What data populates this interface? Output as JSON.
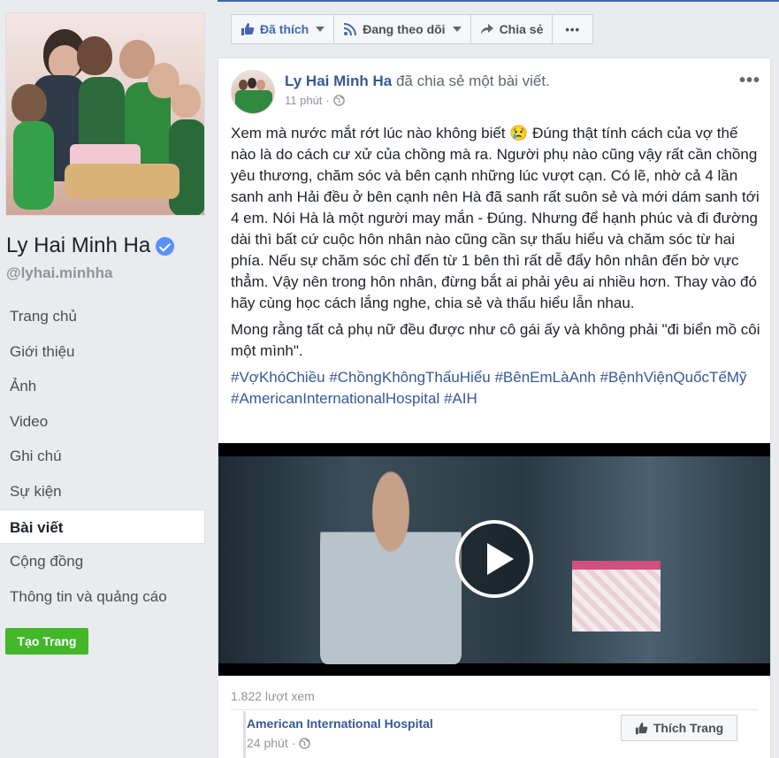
{
  "page": {
    "name": "Ly Hai Minh Ha",
    "handle": "@lyhai.minhha",
    "create_page_label": "Tạo Trang"
  },
  "nav": {
    "items": [
      {
        "label": "Trang chủ",
        "active": false
      },
      {
        "label": "Giới thiệu",
        "active": false
      },
      {
        "label": "Ảnh",
        "active": false
      },
      {
        "label": "Video",
        "active": false
      },
      {
        "label": "Ghi chú",
        "active": false
      },
      {
        "label": "Sự kiện",
        "active": false
      },
      {
        "label": "Bài viết",
        "active": true
      },
      {
        "label": "Cộng đồng",
        "active": false
      },
      {
        "label": "Thông tin và quảng cáo",
        "active": false
      }
    ]
  },
  "actions": {
    "liked_label": "Đã thích",
    "following_label": "Đang theo dõi",
    "share_label": "Chia sẻ",
    "more_label": "•••"
  },
  "post": {
    "author": "Ly Hai Minh Ha",
    "action_text": "đã chia sẻ một bài viết.",
    "time": "11 phút",
    "menu_label": "•••",
    "paragraph1": "Xem mà nước mắt rớt lúc nào không biết 😢 Đúng thật tính cách của vợ thế nào là do cách cư xử của chồng mà ra. Người phụ nào cũng vậy rất cần chồng yêu thương, chăm sóc và bên cạnh những lúc vượt cạn. Có lẽ, nhờ cả 4 lần sanh anh Hải đều ở bên cạnh nên Hà đã sanh rất suôn sẻ và mới dám sanh tới 4 em. Nói Hà là một người may mắn - Đúng. Nhưng để hạnh phúc và đi đường dài thì bất cứ cuộc hôn nhân nào cũng cần sự thấu hiểu và chăm sóc từ hai phía. Nếu sự chăm sóc chỉ đến từ 1 bên thì rất dễ đẩy hôn nhân đến bờ vực thẳm. Vậy nên trong hôn nhân, đừng bắt ai phải yêu ai nhiều hơn. Thay vào đó hãy cùng học cách lắng nghe, chia sẻ và thấu hiểu lẫn nhau.",
    "paragraph2": "Mong rằng tất cả phụ nữ đều được như cô gái ấy và không phải \"đi biển mồ côi một mình\".",
    "hashtags": "#VợKhóChiều #ChồngKhôngThấuHiểu #BênEmLàAnh #BệnhViệnQuốcTếMỹ #AmericanInternationalHospital #AIH",
    "views": "1.822 lượt xem"
  },
  "shared": {
    "name": "American International Hospital",
    "time": "24 phút",
    "like_page_label": "Thích Trang"
  },
  "colors": {
    "link": "#365899",
    "accent": "#4267b2",
    "green_button": "#42b72a",
    "verified": "#5890ff"
  }
}
